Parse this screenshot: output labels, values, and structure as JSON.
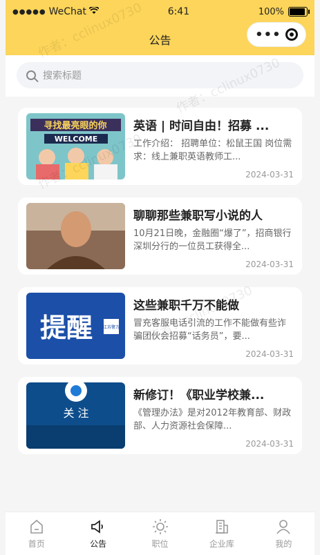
{
  "status": {
    "carrier": "WeChat",
    "time": "6:41",
    "battery": "100%",
    "battery_level": 100
  },
  "nav": {
    "title": "公告"
  },
  "search": {
    "placeholder": "搜索标题"
  },
  "articles": [
    {
      "title": "英语 | 时间自由！招募 ...",
      "desc": "工作介绍： 招聘单位：松鼠王国 岗位需求：线上兼职英语教师工...",
      "date": "2024-03-31"
    },
    {
      "title": "聊聊那些兼职写小说的人",
      "desc": "10月21日晚，金融圈“爆了”，招商银行深圳分行的一位员工获得全...",
      "date": "2024-03-31"
    },
    {
      "title": "这些兼职千万不能做",
      "desc": "冒充客服电话引流的工作不能做有些诈骗团伙会招募“话务员”，要...",
      "date": "2024-03-31"
    },
    {
      "title": "新修订！《职业学校兼...",
      "desc": "《管理办法》是对2012年教育部、财政部、人力资源社会保障...",
      "date": "2024-03-31"
    }
  ],
  "thumbs": {
    "t1_text": "寻找最亮眼的你",
    "t1_sub": "WELCOME",
    "t3_text": "提醒",
    "t3_badge": "江苏警方",
    "t4_text": "关 注"
  },
  "tabs": [
    {
      "label": "首页"
    },
    {
      "label": "公告"
    },
    {
      "label": "职位"
    },
    {
      "label": "企业库"
    },
    {
      "label": "我的"
    }
  ],
  "watermark": "作者：cclinux0730"
}
